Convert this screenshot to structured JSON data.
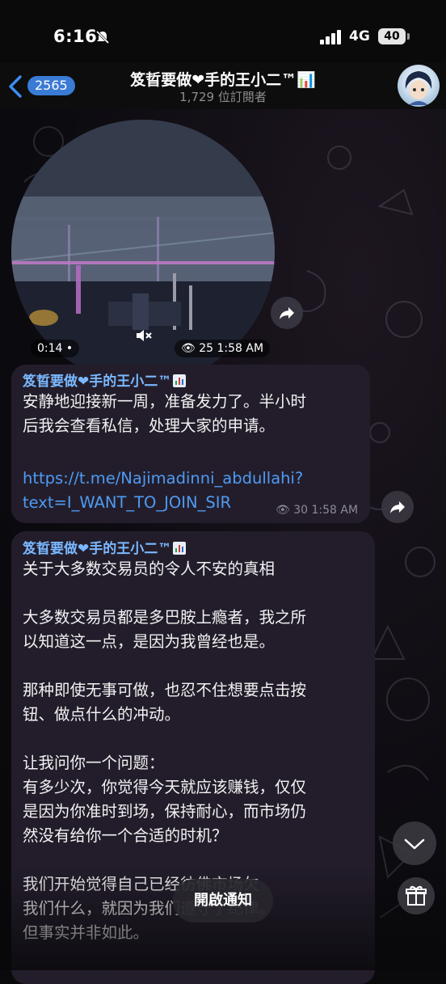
{
  "status_bar": {
    "time": "6:16",
    "network": "4G",
    "battery": "40"
  },
  "header": {
    "back_count": "2565",
    "title": "笈晢要做❤手的王小二™📊",
    "subscribers": "1,729 位訂閱者"
  },
  "video": {
    "duration": "0:14 •",
    "views_time": "👁 25 1:58 AM"
  },
  "messages": [
    {
      "author": "笈晢要做❤手的王小二™",
      "text": "安静地迎接新一周，准备发力了。半小时\n后我会查看私信，处理大家的申请。",
      "link_line1": "https://t.me/Najimadinni_abdullahi?",
      "link_line2": "text=I_WANT_TO_JOIN_SIR",
      "meta": "👁 30 1:58 AM"
    },
    {
      "author": "笈晢要做❤手的王小二™",
      "text": "关于大多数交易员的令人不安的真相\n\n大多数交易员都是多巴胺上瘾者，我之所\n以知道这一点，是因为我曾经也是。\n\n那种即使无事可做，也忍不住想要点击按\n钮、做点什么的冲动。\n\n让我问你一个问题：\n有多少次，你觉得今天就应该赚钱，仅仅\n是因为你准时到场，保持耐心，而市场仍\n然没有给你一个合适的时机？\n\n我们开始觉得自己已经彷佛市场欠\n我们什么，就因为我们遵守了纪律。\n但事实并非如此。"
    }
  ],
  "notify_button": "開啟通知",
  "colors": {
    "accent": "#3a7bd5",
    "link": "#4e9bf2",
    "author": "#7ab8ff",
    "bubble": "#231d2b"
  }
}
